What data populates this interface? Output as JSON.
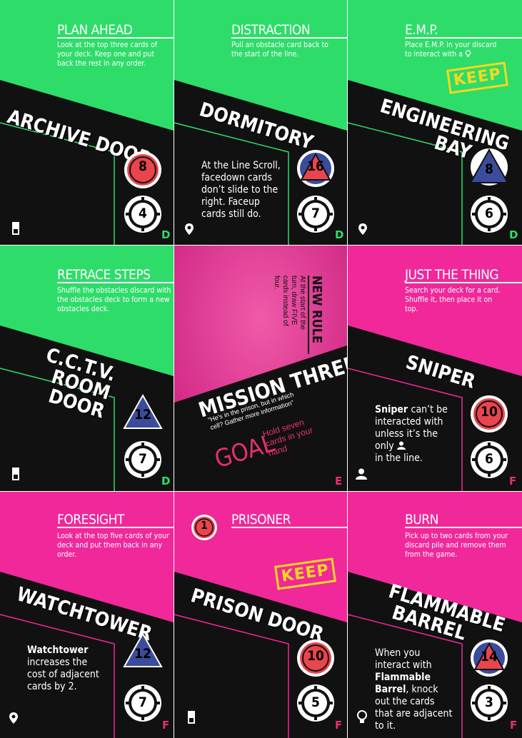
{
  "colors": {
    "green": "#2edc6a",
    "pink": "#f0289a",
    "black": "#111111",
    "red": "#e8454e",
    "blue": "#3b4c9c",
    "set_green": "#2edc6a",
    "set_pink": "#e8306a",
    "keep": "#f5d81f"
  },
  "cards": [
    {
      "title": "PLAN AHEAD",
      "desc": "Look at the top three cards of your deck. Keep one and put back the rest in any order.",
      "name": "ARCHIVE DOOR",
      "rule": "",
      "red": "8",
      "white": "4",
      "set": "D",
      "icon": "door-icon"
    },
    {
      "title": "DISTRACTION",
      "desc": "Pull an obstacle card back to the start of the line.",
      "name": "DORMITORY",
      "rule": "At the Line Scroll, facedown cards don’t slide to the right. Faceup cards still do.",
      "blue": "16",
      "white": "7",
      "set": "D",
      "icon": "location-pin-icon"
    },
    {
      "title": "E.M.P.",
      "desc": "Place E.M.P. in your discard to interact with a",
      "keep": "KEEP",
      "name": "ENGINEERING BAY",
      "blue": "8",
      "white": "6",
      "set": "D",
      "icon": "location-pin-icon"
    },
    {
      "title": "RETRACE STEPS",
      "desc": "Shuffle the obstacles discard with the obstacles deck to form a new obstacles deck.",
      "name": "C.C.T.V. ROOM DOOR",
      "blue": "12",
      "white": "7",
      "set": "D",
      "icon": "door-icon"
    },
    {
      "mission": "MISSION THREE",
      "new_rule_title": "NEW RULE",
      "new_rule": "At the start of the turn, draw FIVE cards instead of four.",
      "quote": "\"He's in the prison, but in which cell? Gather more information\"",
      "goal_label": "GOAL",
      "goal": "Hold seven cards in your hand",
      "set": "E"
    },
    {
      "title": "JUST THE THING",
      "desc": "Search your deck for a card. Shuffle it, then place it on top.",
      "name": "SNIPER",
      "rule_bold": "Sniper",
      "rule": "can’t be interacted with unless it’s the only",
      "rule_end": "in the line.",
      "red": "10",
      "white": "6",
      "set": "F",
      "icon": "person-icon"
    },
    {
      "title": "FORESIGHT",
      "desc": "Look at the top five cards of your deck and put them back in any order.",
      "name": "WATCHTOWER",
      "rule_bold": "Watchtower",
      "rule": "increases the cost of adjacent cards by 2.",
      "blue": "12",
      "white": "7",
      "set": "F",
      "icon": "location-pin-icon"
    },
    {
      "title": "PRISONER",
      "badge": "1",
      "keep": "KEEP",
      "name": "PRISON DOOR",
      "red": "10",
      "white": "5",
      "set": "F",
      "icon": "door-icon"
    },
    {
      "title": "BURN",
      "desc": "Pick up to two cards from your discard pile and remove them from the game.",
      "name": "FLAMMABLE BARREL",
      "rule_pre": "When you interact with",
      "rule_bold": "Flammable Barrel",
      "rule": ", knock out the cards that are adjacent to it.",
      "blue": "14",
      "white": "3",
      "set": "F",
      "icon": "lightbulb-icon"
    }
  ]
}
